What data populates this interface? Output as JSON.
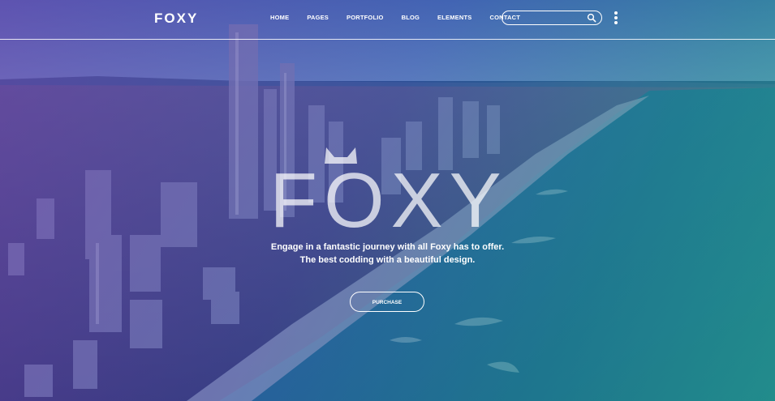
{
  "brand": {
    "logo_text": "FOXY"
  },
  "nav": {
    "items": [
      "HOME",
      "PAGES",
      "PORTFOLIO",
      "BLOG",
      "ELEMENTS",
      "CONTACT"
    ]
  },
  "search": {
    "placeholder": "",
    "value": ""
  },
  "hero": {
    "title": "FOXY",
    "tagline_line1": "Engage in a fantastic journey with all Foxy has to offer.",
    "tagline_line2": "The best codding with a beautiful design.",
    "cta_label": "PURCHASE"
  },
  "colors": {
    "accent_purple": "#6e3caa",
    "accent_green": "#28be8c",
    "text": "#ffffff"
  },
  "icons": [
    "search-icon",
    "menu-dots-icon"
  ]
}
